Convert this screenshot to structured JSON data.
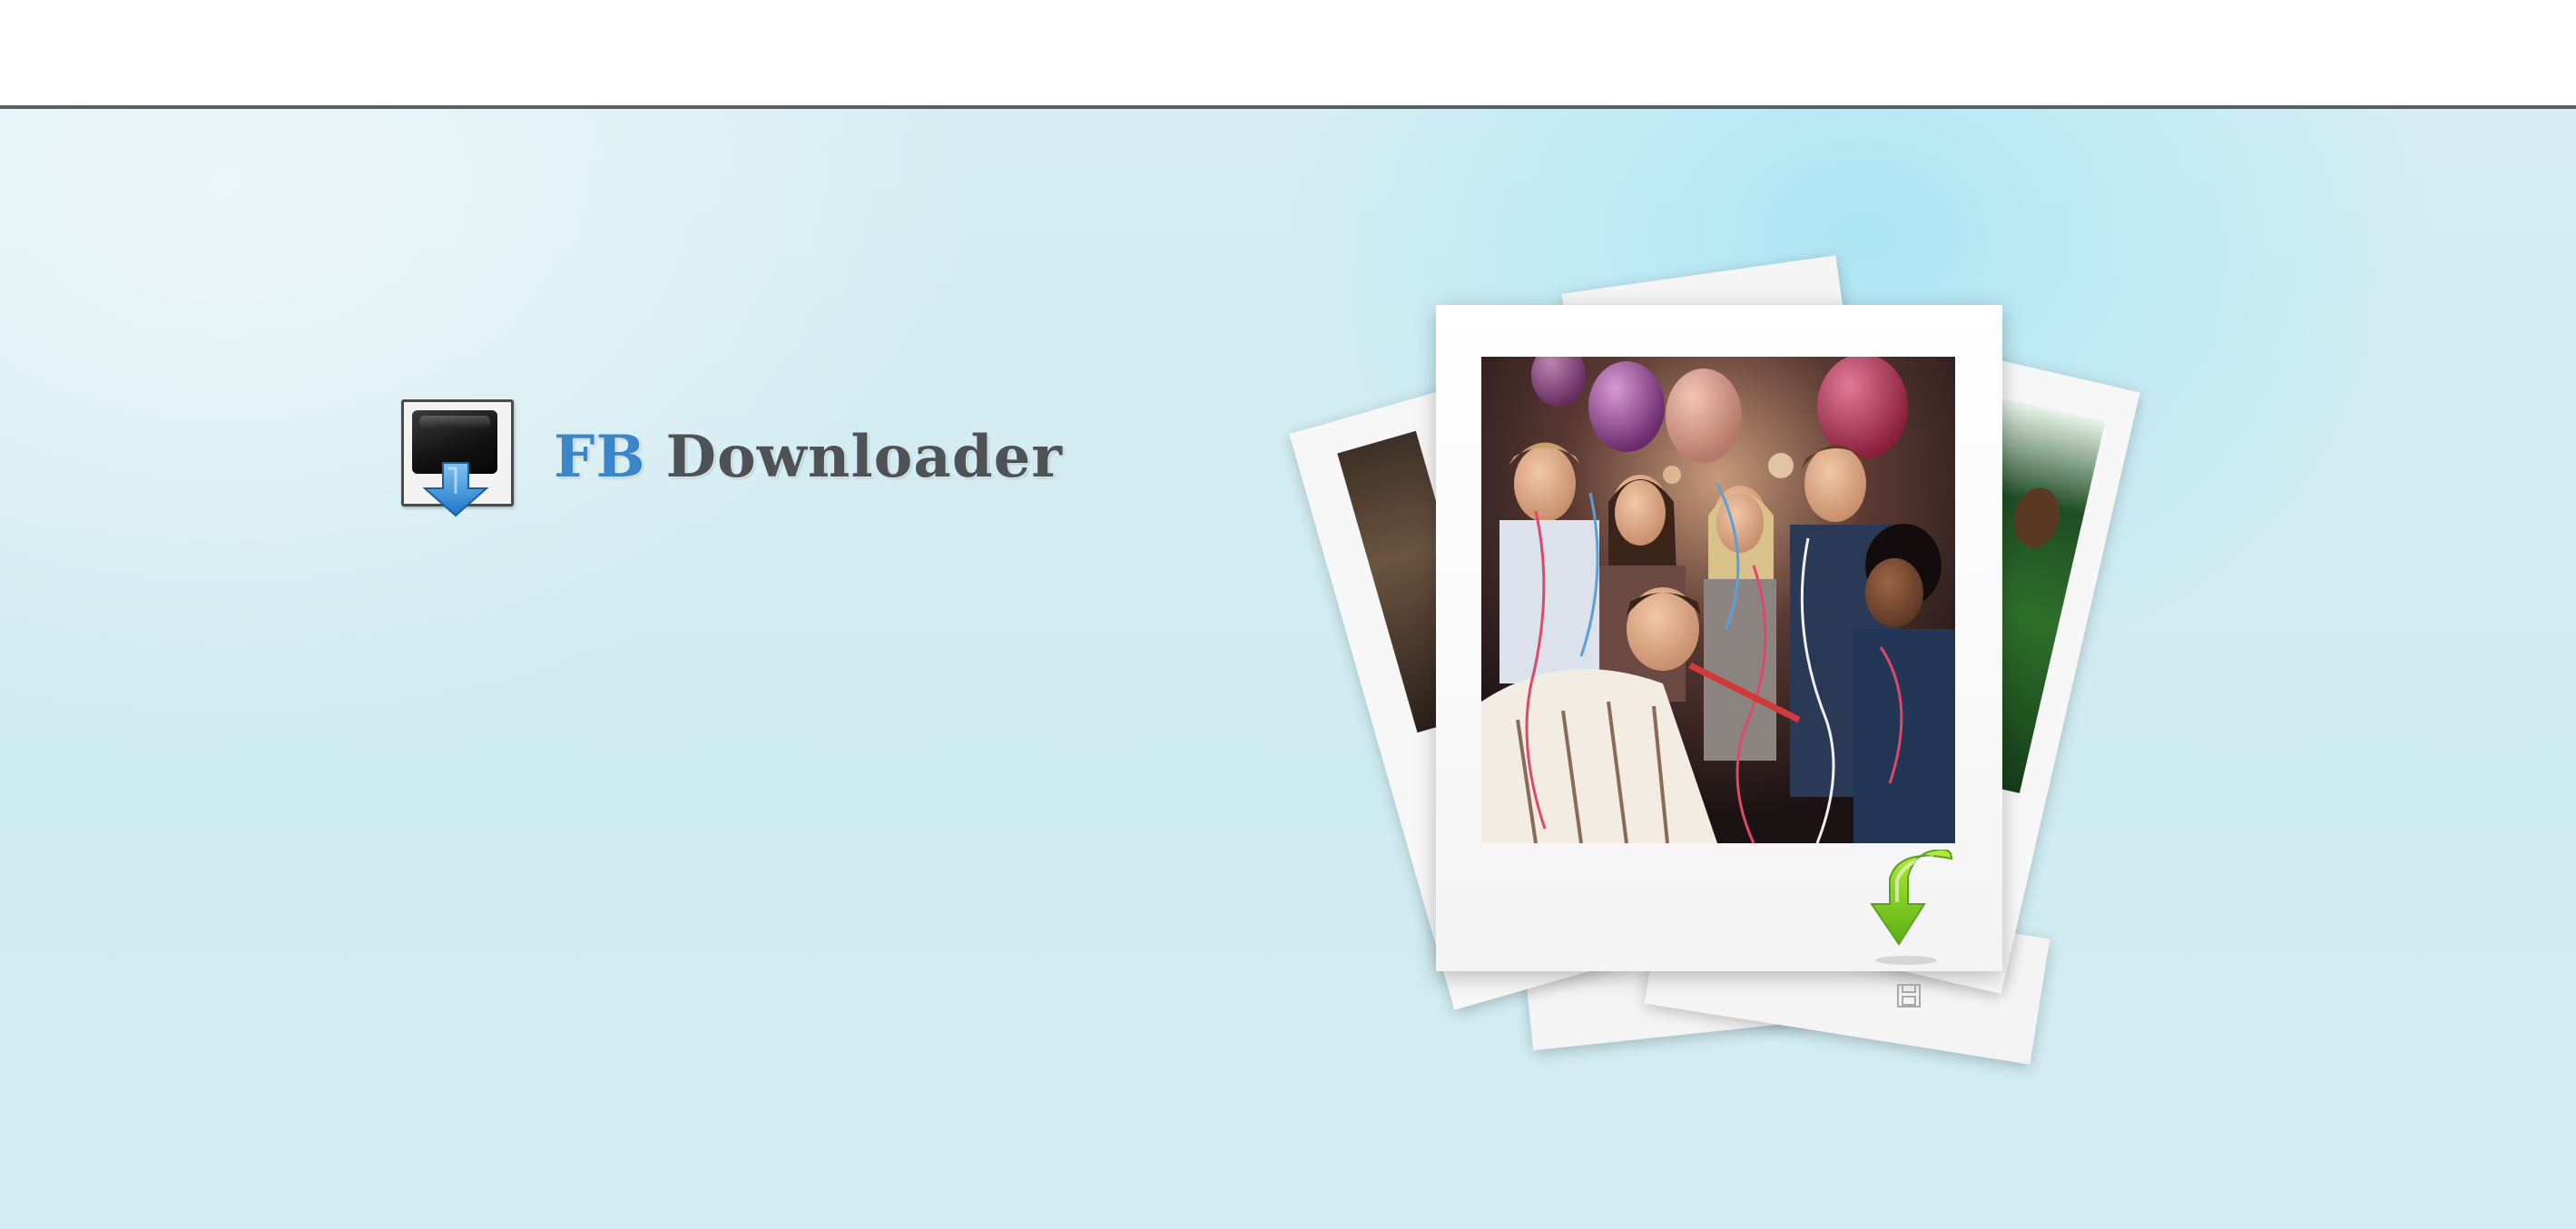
{
  "logo": {
    "prefix": "FB",
    "name": "Downloader",
    "colors": {
      "prefix": "#3a86c8",
      "name": "#4f5255"
    }
  },
  "icons": {
    "logo": "monitor-download-icon",
    "download": "green-download-arrow-icon",
    "save": "floppy-disk-icon"
  },
  "colors": {
    "top_bar": "#ffffff",
    "divider": "#5b5f62",
    "hero_background": "#d4edf3",
    "download_arrow": "#7ccd1a"
  }
}
